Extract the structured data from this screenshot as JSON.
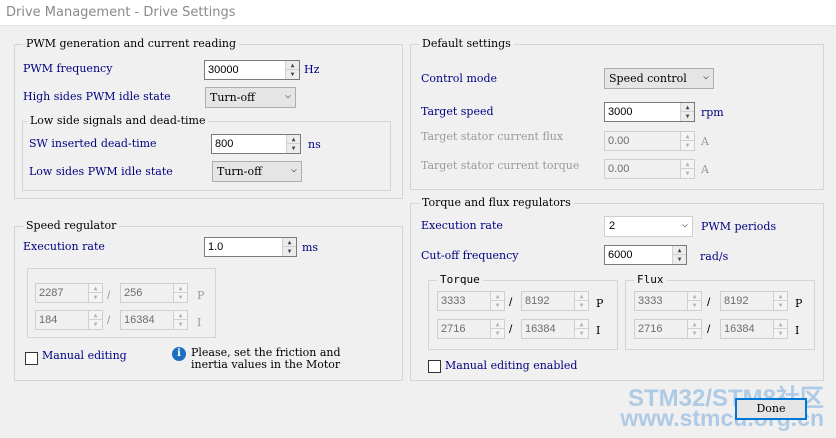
{
  "window": {
    "title": "Drive Management - Drive Settings"
  },
  "pwm": {
    "title": "PWM generation and current reading",
    "freq_label": "PWM frequency",
    "freq_value": "30000",
    "freq_unit": "Hz",
    "high_label": "High sides PWM idle state",
    "high_value": "Turn-off",
    "low": {
      "title": "Low side signals and dead-time",
      "dead_label": "SW inserted dead-time",
      "dead_value": "800",
      "dead_unit": "ns",
      "idle_label": "Low sides PWM idle state",
      "idle_value": "Turn-off"
    }
  },
  "speed": {
    "title": "Speed regulator",
    "exec_label": "Execution rate",
    "exec_value": "1.0",
    "exec_unit": "ms",
    "kp_num": "2287",
    "kp_den": "256",
    "p": "P",
    "ki_num": "184",
    "ki_den": "16384",
    "i": "I",
    "slash": "/",
    "manual_label": "Manual editing",
    "info_icon": "i",
    "info_line1": "Please, set the friction and",
    "info_line2": "inertia values in the Motor"
  },
  "defaults": {
    "title": "Default settings",
    "mode_label": "Control mode",
    "mode_value": "Speed control",
    "speed_label": "Target speed",
    "speed_value": "3000",
    "speed_unit": "rpm",
    "flux_label": "Target stator current flux",
    "flux_value": "0.00",
    "flux_unit": "A",
    "torque_label": "Target stator current torque",
    "torque_value": "0.00",
    "torque_unit": "A"
  },
  "tf": {
    "title": "Torque and flux regulators",
    "exec_label": "Execution rate",
    "exec_value": "2",
    "exec_unit": "PWM periods",
    "cut_label": "Cut-off frequency",
    "cut_value": "6000",
    "cut_unit": "rad/s",
    "torque": {
      "title": "Torque",
      "kp_num": "3333",
      "kp_den": "8192",
      "ki_num": "2716",
      "ki_den": "16384"
    },
    "flux": {
      "title": "Flux",
      "kp_num": "3333",
      "kp_den": "8192",
      "ki_num": "2716",
      "ki_den": "16384"
    },
    "p": "P",
    "i": "I",
    "slash": "/",
    "manual_label": "Manual editing enabled"
  },
  "done_label": "Done",
  "watermark": {
    "line1": "STM32/STM8社区",
    "line2": "www.stmcu.org.cn"
  }
}
